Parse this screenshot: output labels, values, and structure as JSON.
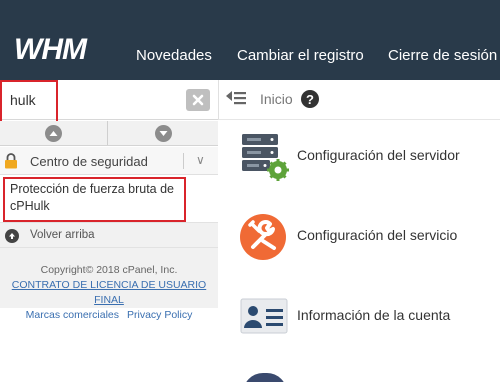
{
  "header": {
    "logo_text": "WHM",
    "nav": [
      {
        "label": "Novedades"
      },
      {
        "label": "Cambiar el registro"
      },
      {
        "label": "Cierre de sesión (r"
      }
    ]
  },
  "sidebar": {
    "search": {
      "value": "hulk",
      "placeholder": ""
    },
    "category": {
      "label": "Centro de seguridad"
    },
    "result": {
      "label": "Protección de fuerza bruta de cPHulk"
    },
    "back": {
      "label": "Volver arriba"
    },
    "footer": {
      "copyright": "Copyright© 2018 cPanel, Inc.",
      "license": "CONTRATO DE LICENCIA DE USUARIO FINAL",
      "trademarks": "Marcas comerciales",
      "privacy": "Privacy Policy"
    }
  },
  "breadcrumb": {
    "home": "Inicio"
  },
  "features": [
    {
      "label": "Configuración del servidor",
      "icon": "server-gear-icon"
    },
    {
      "label": "Configuración del servicio",
      "icon": "wrench-icon"
    },
    {
      "label": "Información de la cuenta",
      "icon": "account-card-icon"
    }
  ],
  "colors": {
    "header_bg": "#293a4a",
    "highlight": "#d9242b",
    "link": "#3a6fb0",
    "accent_green": "#5ea33a",
    "accent_orange": "#f06a35"
  }
}
